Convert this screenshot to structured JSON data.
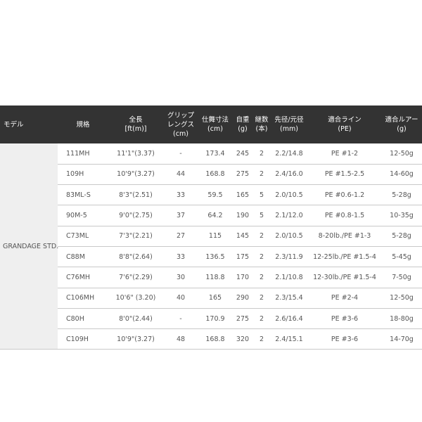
{
  "headers": {
    "model": "モデル",
    "spec": "規格",
    "length": [
      "全長",
      "[ft(m)]"
    ],
    "grip": [
      "グリップ",
      "レングス",
      "(cm)"
    ],
    "closed": [
      "仕舞寸法",
      "(cm)"
    ],
    "weight": [
      "自重",
      "(g)"
    ],
    "pieces": [
      "継数",
      "(本)"
    ],
    "diameter": [
      "先径/元径",
      "(mm)"
    ],
    "line": [
      "適合ライン",
      "(PE)"
    ],
    "lure": [
      "適合ルアー",
      "(g)"
    ]
  },
  "model_name": "GRANDAGE STD.",
  "rows": [
    {
      "spec": "111MH",
      "length": "11'1\"(3.37)",
      "grip": "-",
      "closed": "173.4",
      "weight": "245",
      "pieces": "2",
      "diameter": "2.2/14.8",
      "line": "PE #1-2",
      "lure": "12-50g"
    },
    {
      "spec": "109H",
      "length": "10'9\"(3.27)",
      "grip": "44",
      "closed": "168.8",
      "weight": "275",
      "pieces": "2",
      "diameter": "2.4/16.0",
      "line": "PE #1.5-2.5",
      "lure": "14-60g"
    },
    {
      "spec": "83ML-S",
      "length": "8'3\"(2.51)",
      "grip": "33",
      "closed": "59.5",
      "weight": "165",
      "pieces": "5",
      "diameter": "2.0/10.5",
      "line": "PE #0.6-1.2",
      "lure": "5-28g"
    },
    {
      "spec": "90M-5",
      "length": "9'0\"(2.75)",
      "grip": "37",
      "closed": "64.2",
      "weight": "190",
      "pieces": "5",
      "diameter": "2.1/12.0",
      "line": "PE #0.8-1.5",
      "lure": "10-35g"
    },
    {
      "spec": "C73ML",
      "length": "7'3\"(2.21)",
      "grip": "27",
      "closed": "115",
      "weight": "145",
      "pieces": "2",
      "diameter": "2.0/10.5",
      "line": "8-20lb./PE #1-3",
      "lure": "5-28g"
    },
    {
      "spec": "C88M",
      "length": "8'8\"(2.64)",
      "grip": "33",
      "closed": "136.5",
      "weight": "175",
      "pieces": "2",
      "diameter": "2.3/11.9",
      "line": "12-25lb./PE #1.5-4",
      "lure": "5-45g"
    },
    {
      "spec": "C76MH",
      "length": "7'6\"(2.29)",
      "grip": "30",
      "closed": "118.8",
      "weight": "170",
      "pieces": "2",
      "diameter": "2.1/10.8",
      "line": "12-30lb./PE #1.5-4",
      "lure": "7-50g"
    },
    {
      "spec": "C106MH",
      "length": "10'6\" (3.20)",
      "grip": "40",
      "closed": "165",
      "weight": "290",
      "pieces": "2",
      "diameter": "2.3/15.4",
      "line": "PE #2-4",
      "lure": "12-50g"
    },
    {
      "spec": "C80H",
      "length": "8'0\"(2.44)",
      "grip": "-",
      "closed": "170.9",
      "weight": "275",
      "pieces": "2",
      "diameter": "2.6/16.4",
      "line": "PE #3-6",
      "lure": "18-80g"
    },
    {
      "spec": "C109H",
      "length": "10'9\"(3.27)",
      "grip": "48",
      "closed": "168.8",
      "weight": "320",
      "pieces": "2",
      "diameter": "2.4/15.1",
      "line": "PE #3-6",
      "lure": "14-70g"
    }
  ]
}
